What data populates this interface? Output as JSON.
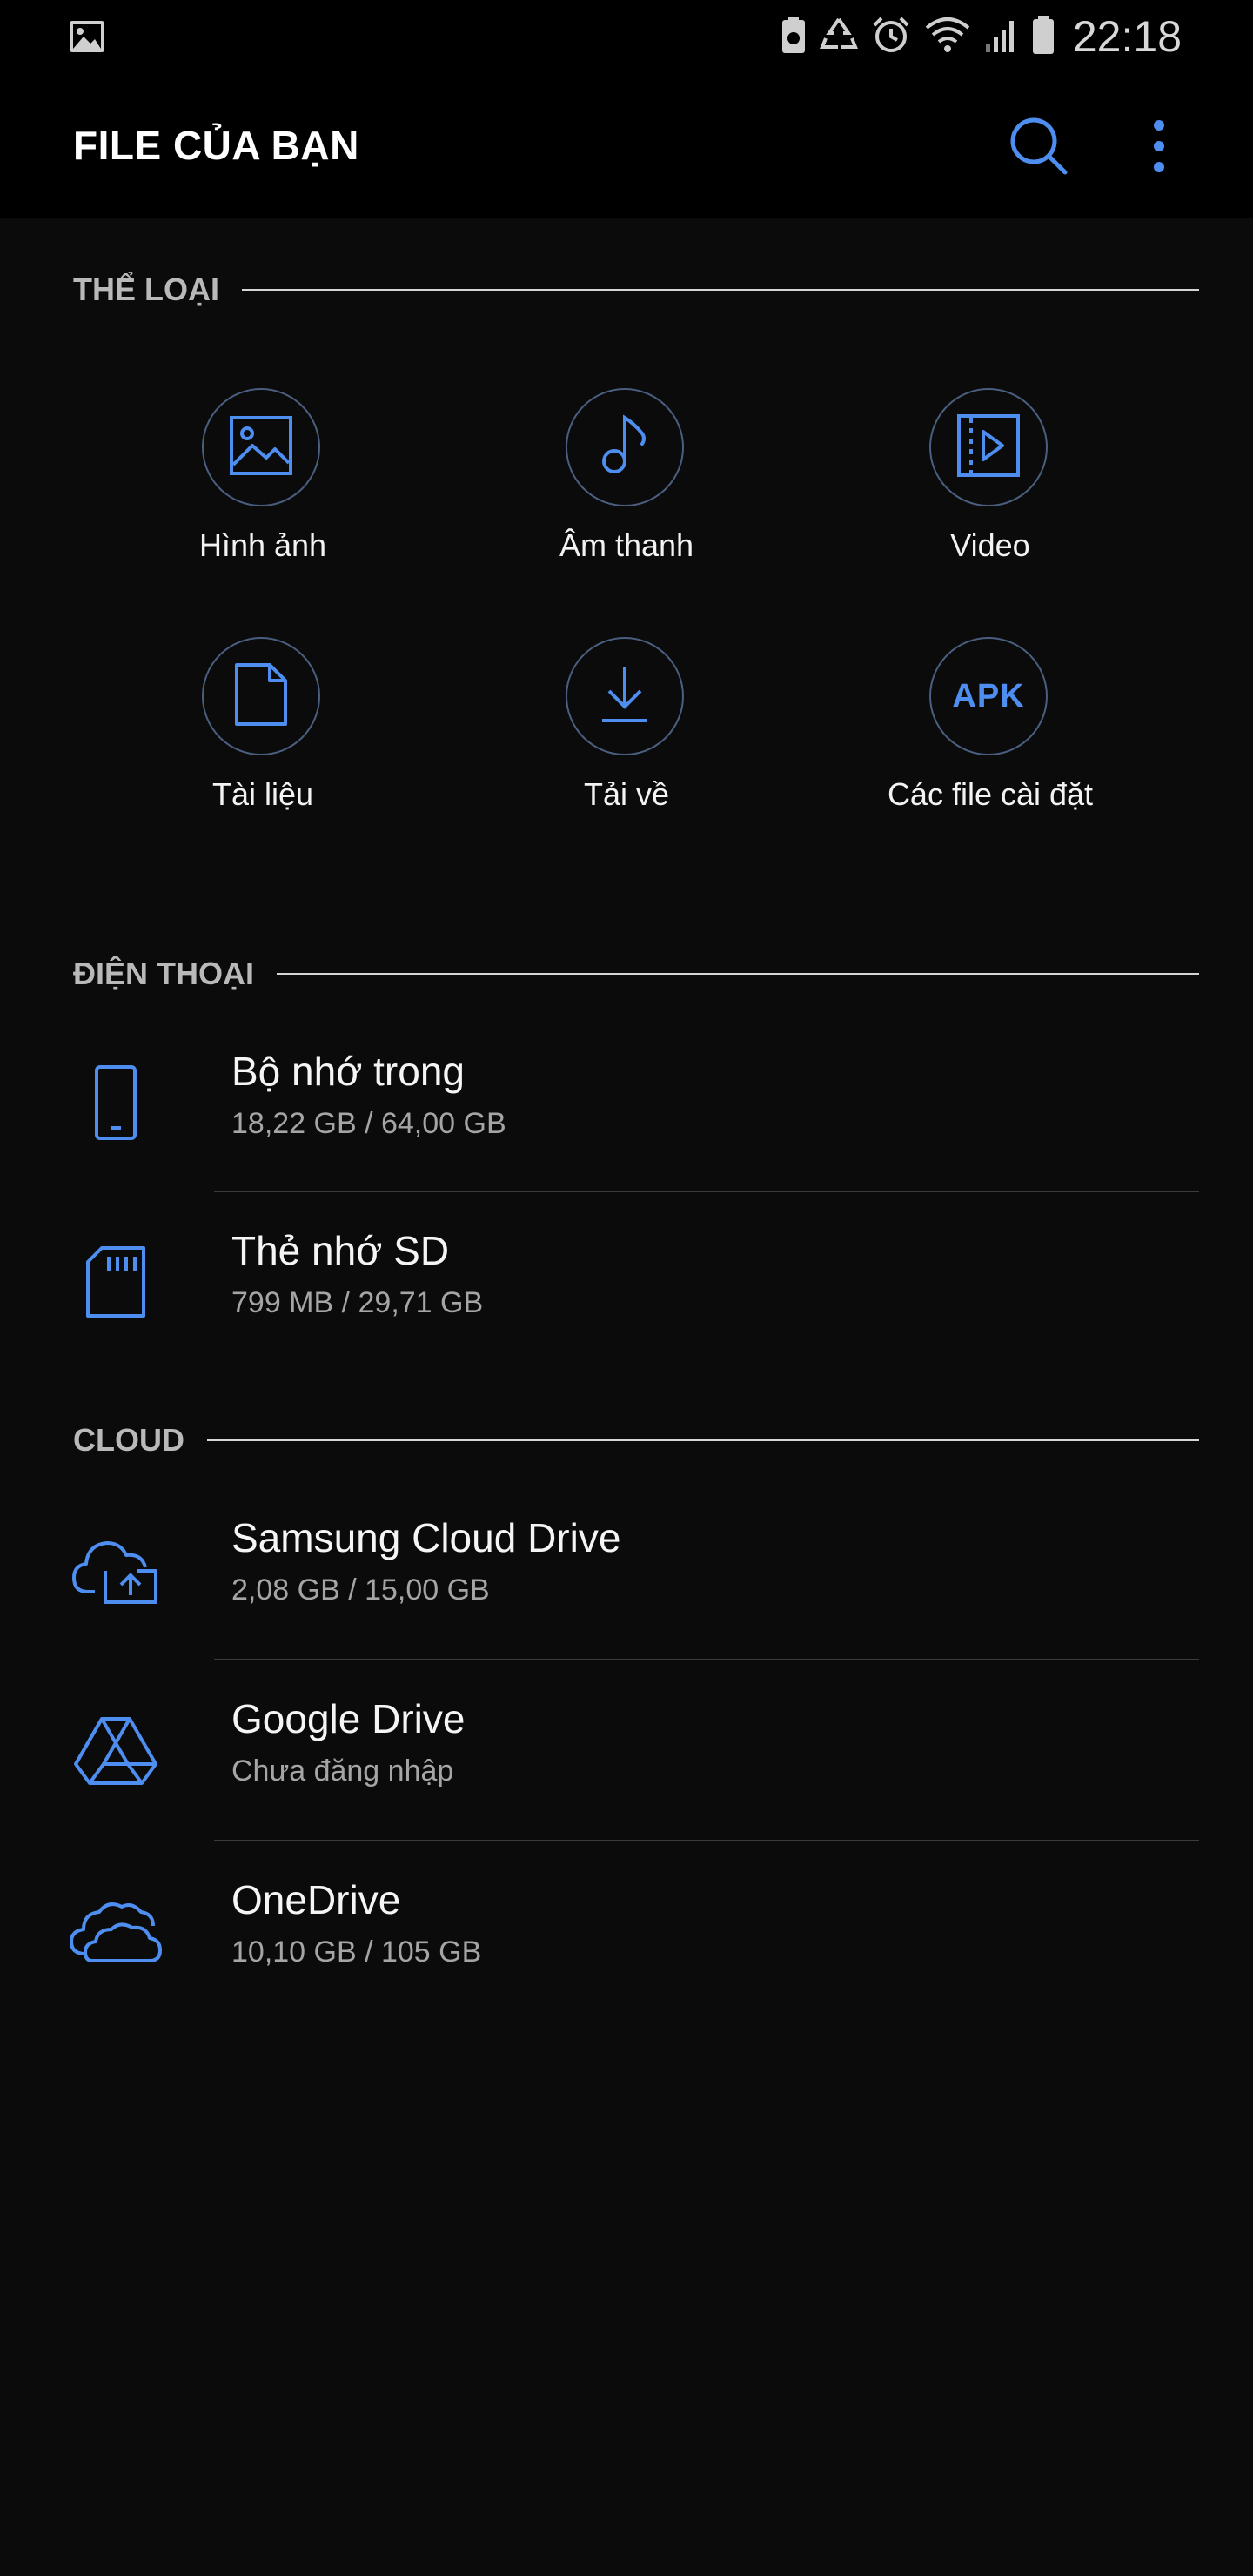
{
  "status_bar": {
    "time": "22:18",
    "icons": [
      "gallery-icon",
      "battery-saver-icon",
      "recycle-icon",
      "alarm-icon",
      "wifi-icon",
      "signal-icon",
      "battery-icon"
    ]
  },
  "app_bar": {
    "title": "FILE CỦA BẠN",
    "search_icon": "search-icon",
    "more_icon": "more-vertical-icon"
  },
  "colors": {
    "accent": "#4d8ef0",
    "background": "#0b0b0b",
    "header_text": "#b9b9b9"
  },
  "categories": {
    "header": "THỂ LOẠI",
    "items": [
      {
        "label": "Hình ảnh",
        "icon": "image-icon"
      },
      {
        "label": "Âm thanh",
        "icon": "music-note-icon"
      },
      {
        "label": "Video",
        "icon": "video-icon"
      },
      {
        "label": "Tài liệu",
        "icon": "document-icon"
      },
      {
        "label": "Tải về",
        "icon": "download-icon"
      },
      {
        "label": "Các file cài đặt",
        "icon": "apk-icon",
        "icon_text": "APK"
      }
    ]
  },
  "phone": {
    "header": "ĐIỆN THOẠI",
    "items": [
      {
        "title": "Bộ nhớ trong",
        "subtitle": "18,22 GB / 64,00 GB",
        "icon": "phone-icon"
      },
      {
        "title": "Thẻ nhớ SD",
        "subtitle": "799 MB / 29,71 GB",
        "icon": "sd-card-icon"
      }
    ]
  },
  "cloud": {
    "header": "CLOUD",
    "items": [
      {
        "title": "Samsung Cloud Drive",
        "subtitle": "2,08 GB / 15,00 GB",
        "icon": "samsung-cloud-icon"
      },
      {
        "title": "Google Drive",
        "subtitle": "Chưa đăng nhập",
        "icon": "google-drive-icon"
      },
      {
        "title": "OneDrive",
        "subtitle": "10,10 GB / 105 GB",
        "icon": "onedrive-icon"
      }
    ]
  }
}
